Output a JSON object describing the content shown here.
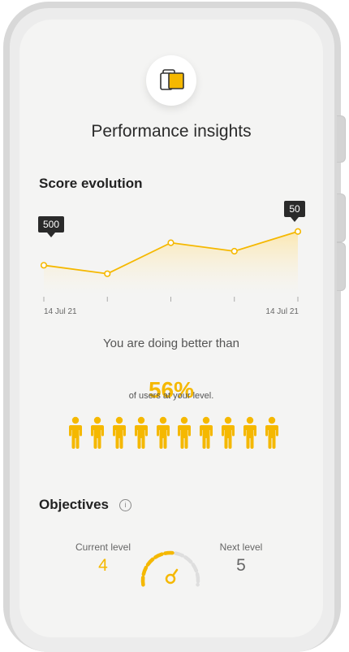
{
  "header": {
    "title": "Performance insights"
  },
  "score": {
    "section_title": "Score evolution",
    "start_badge": "500",
    "end_badge": "50",
    "date_start": "14 Jul 21",
    "date_end": "14 Jul 21"
  },
  "comparison": {
    "lead": "You are doing better than",
    "percent": "56%",
    "tail": "of users at your level.",
    "people_total": 10,
    "people_highlighted": 10
  },
  "objectives": {
    "section_title": "Objectives",
    "current_label": "Current level",
    "current_value": "4",
    "next_label": "Next level",
    "next_value": "5",
    "progress_fraction": 0.55
  },
  "colors": {
    "accent": "#f5b800",
    "accent_light": "#fdebb0",
    "badge": "#2a2a2a"
  },
  "chart_data": {
    "type": "area",
    "title": "Score evolution",
    "x_tick_labels": [
      "14 Jul 21",
      "",
      "",
      "",
      "14 Jul 21"
    ],
    "points": [
      {
        "x": 0,
        "y": 500
      },
      {
        "x": 1,
        "y": 470
      },
      {
        "x": 2,
        "y": 580
      },
      {
        "x": 3,
        "y": 550
      },
      {
        "x": 4,
        "y": 620
      }
    ],
    "point_labels": [
      "500",
      "",
      "",
      "",
      "50"
    ],
    "ylim": [
      420,
      680
    ],
    "grid": false
  }
}
